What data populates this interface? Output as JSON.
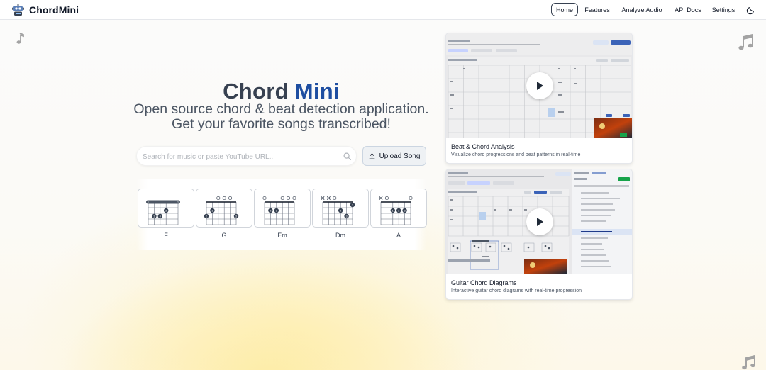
{
  "brand": {
    "name": "ChordMini",
    "logo_icon": "robot-logo-icon"
  },
  "nav": {
    "items": [
      {
        "label": "Home",
        "active": true
      },
      {
        "label": "Features",
        "active": false
      },
      {
        "label": "Analyze Audio",
        "active": false
      },
      {
        "label": "API Docs",
        "active": false
      },
      {
        "label": "Settings",
        "active": false
      }
    ],
    "theme_toggle_icon": "moon-icon"
  },
  "hero": {
    "title_part1": "Chord",
    "title_part2": "Mini",
    "subtitle": "Open source chord & beat detection application. Get your favorite songs transcribed!"
  },
  "search": {
    "placeholder": "Search for music or paste YouTube URL...",
    "value": "",
    "icon": "search-icon"
  },
  "upload": {
    "label": "Upload Song",
    "icon": "upload-icon"
  },
  "chords": [
    {
      "name": "F"
    },
    {
      "name": "G"
    },
    {
      "name": "Em"
    },
    {
      "name": "Dm"
    },
    {
      "name": "A"
    }
  ],
  "demos": [
    {
      "title": "Beat & Chord Analysis",
      "description": "Visualize chord progressions and beat patterns in real-time",
      "play_icon": "play-icon"
    },
    {
      "title": "Guitar Chord Diagrams",
      "description": "Interactive guitar chord diagrams with real-time progression",
      "play_icon": "play-icon"
    }
  ],
  "colors": {
    "accent": "#1e4ea1",
    "title_gray": "#374151",
    "glow_yellow": "#fdeba0"
  }
}
